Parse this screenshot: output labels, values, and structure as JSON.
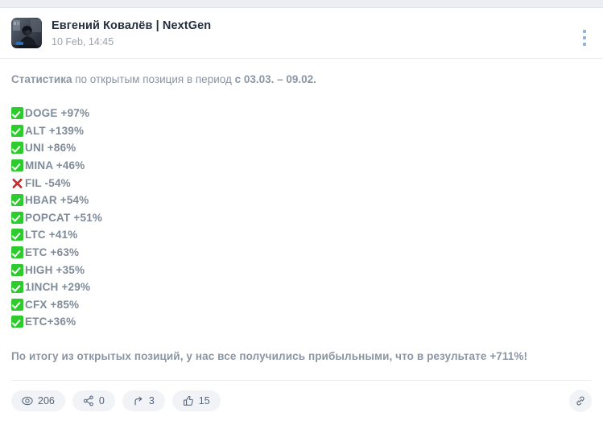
{
  "top_strip": {
    "name": "window-chrome-strip"
  },
  "header": {
    "channel_name": "Евгений Ковалёв | NextGen",
    "date": "10 Feb, 14:45",
    "avatar_alt": "avatar-photo",
    "menu_icon": "more-vertical-icon"
  },
  "body": {
    "intro": {
      "bold_lead": "Статистика",
      "middle": " по открытым позиция в период ",
      "bold_tail": "с 03.03. – 09.02."
    },
    "rows": [
      {
        "mark": "check-mark",
        "label": "DOGE +97%"
      },
      {
        "mark": "check-mark",
        "label": "ALT +139%"
      },
      {
        "mark": "check-mark",
        "label": "UNI +86%"
      },
      {
        "mark": "check-mark",
        "label": "MINA +46%"
      },
      {
        "mark": "cross-mark",
        "label": "FIL -54%"
      },
      {
        "mark": "check-mark",
        "label": "HBAR +54%"
      },
      {
        "mark": "check-mark",
        "label": "POPCAT +51%"
      },
      {
        "mark": "check-mark",
        "label": "LTC +41%"
      },
      {
        "mark": "check-mark",
        "label": "ETC +63%"
      },
      {
        "mark": "check-mark",
        "label": "HIGH +35%"
      },
      {
        "mark": "check-mark",
        "label": "1INCH +29%"
      },
      {
        "mark": "check-mark",
        "label": "CFX +85%"
      },
      {
        "mark": "check-mark",
        "label": "ETC+36%"
      }
    ],
    "summary": "По итогу из открытых позиций, у нас все получились прибыльными, что в результате +711%!"
  },
  "footer": {
    "stats": [
      {
        "icon": "views-icon",
        "value": "206"
      },
      {
        "icon": "share-nodes-icon",
        "value": "0"
      },
      {
        "icon": "forward-arrow-icon",
        "value": "3"
      },
      {
        "icon": "thumbs-up-icon",
        "value": "15"
      }
    ],
    "link_icon": "link-icon"
  },
  "colors": {
    "accent_green": "#2ecb2e",
    "accent_red": "#e03131",
    "text_muted": "#8b95a3",
    "text_dark": "#23303f",
    "pill_bg": "#f1f3f7"
  }
}
